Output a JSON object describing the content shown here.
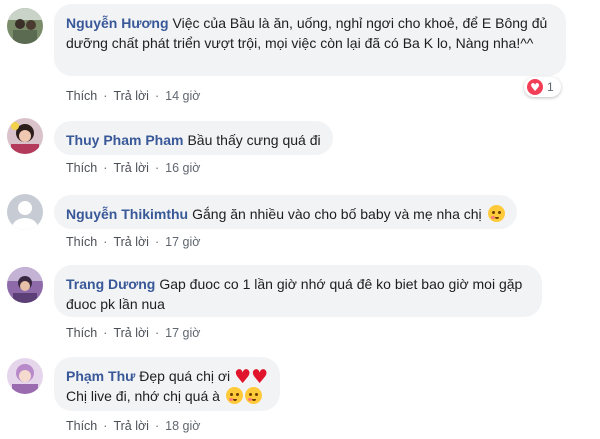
{
  "comments": [
    {
      "author": "Nguyễn Hương",
      "text": "Việc của Bầu là ăn, uống, nghỉ ngơi cho khoẻ, để E Bông đủ dưỡng chất phát triển vượt trội, mọi việc còn lại đã có Ba K lo, Nàng nha!^^",
      "like": "Thích",
      "reply": "Trả lời",
      "time": "14 giờ",
      "reaction_count": "1",
      "reaction_icon": "heart-reaction-icon"
    },
    {
      "author": "Thuy Pham Pham",
      "text": "Bầu thấy cưng quá đi",
      "like": "Thích",
      "reply": "Trả lời",
      "time": "16 giờ"
    },
    {
      "author": "Nguyễn Thikimthu",
      "text": "Gắng ăn nhiều vào cho bố baby và mẹ nha chị",
      "like": "Thích",
      "reply": "Trả lời",
      "time": "17 giờ",
      "emoji": "smiling-face-with-hearts-emoji"
    },
    {
      "author": "Trang Dương",
      "text": "Gap đuoc co 1 lần giờ nhớ quá đê ko biet bao giờ moi gặp đuoc pk lần nua",
      "like": "Thích",
      "reply": "Trả lời",
      "time": "17 giờ"
    },
    {
      "author": "Phạm Thư",
      "text_line1": "Đẹp quá chị ơi",
      "text_line2": "Chị live đi, nhớ chị quá à",
      "like": "Thích",
      "reply": "Trả lời",
      "time": "18 giờ",
      "emoji_line1": [
        "red-heart-emoji",
        "red-heart-emoji"
      ],
      "emoji_line2": [
        "face-blowing-kiss-emoji",
        "face-blowing-kiss-emoji"
      ]
    }
  ],
  "colors": {
    "author": "#385898",
    "bubble": "#f2f3f5",
    "meta": "#606770",
    "heart": "#f33e58"
  }
}
